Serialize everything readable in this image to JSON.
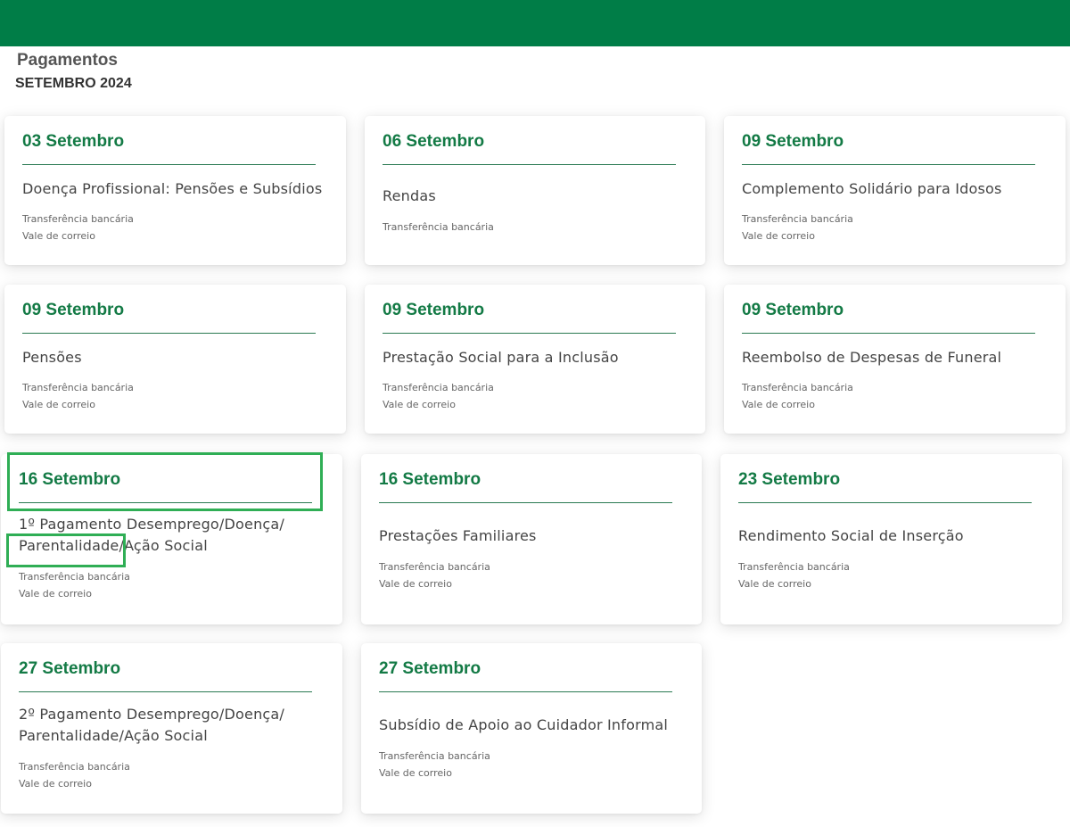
{
  "header": {
    "title": "Pagamentos",
    "subtitle": "SETEMBRO 2024",
    "brand_color": "#007d47"
  },
  "accent_color": "#137a45",
  "highlight_color": "#2fae55",
  "cards": [
    {
      "date": "03 Setembro",
      "title": "Doença Profissional: Pensões e Subsídios",
      "methods": [
        "Transferência bancária",
        "Vale de correio"
      ]
    },
    {
      "date": "06 Setembro",
      "title": "Rendas",
      "methods": [
        "Transferência bancária"
      ]
    },
    {
      "date": "09 Setembro",
      "title": "Complemento Solidário para Idosos",
      "methods": [
        "Transferência bancária",
        "Vale de correio"
      ]
    },
    {
      "date": "09 Setembro",
      "title": "Pensões",
      "methods": [
        "Transferência bancária",
        "Vale de correio"
      ]
    },
    {
      "date": "09 Setembro",
      "title": "Prestação Social para a Inclusão",
      "methods": [
        "Transferência bancária",
        "Vale de correio"
      ]
    },
    {
      "date": "09 Setembro",
      "title": "Reembolso de Despesas de Funeral",
      "methods": [
        "Transferência bancária",
        "Vale de correio"
      ]
    },
    {
      "date": "16 Setembro",
      "title": "1º Pagamento Desemprego/Doença/ Parentalidade/Ação Social",
      "methods": [
        "Transferência bancária",
        "Vale de correio"
      ]
    },
    {
      "date": "16 Setembro",
      "title": "Prestações Familiares",
      "methods": [
        "Transferência bancária",
        "Vale de correio"
      ]
    },
    {
      "date": "23 Setembro",
      "title": "Rendimento Social de Inserção",
      "methods": [
        "Transferência bancária",
        "Vale de correio"
      ]
    },
    {
      "date": "27 Setembro",
      "title": "2º Pagamento Desemprego/Doença/ Parentalidade/Ação Social",
      "methods": [
        "Transferência bancária",
        "Vale de correio"
      ]
    },
    {
      "date": "27 Setembro",
      "title": "Subsídio de Apoio ao Cuidador Informal",
      "methods": [
        "Transferência bancária",
        "Vale de correio"
      ]
    }
  ]
}
